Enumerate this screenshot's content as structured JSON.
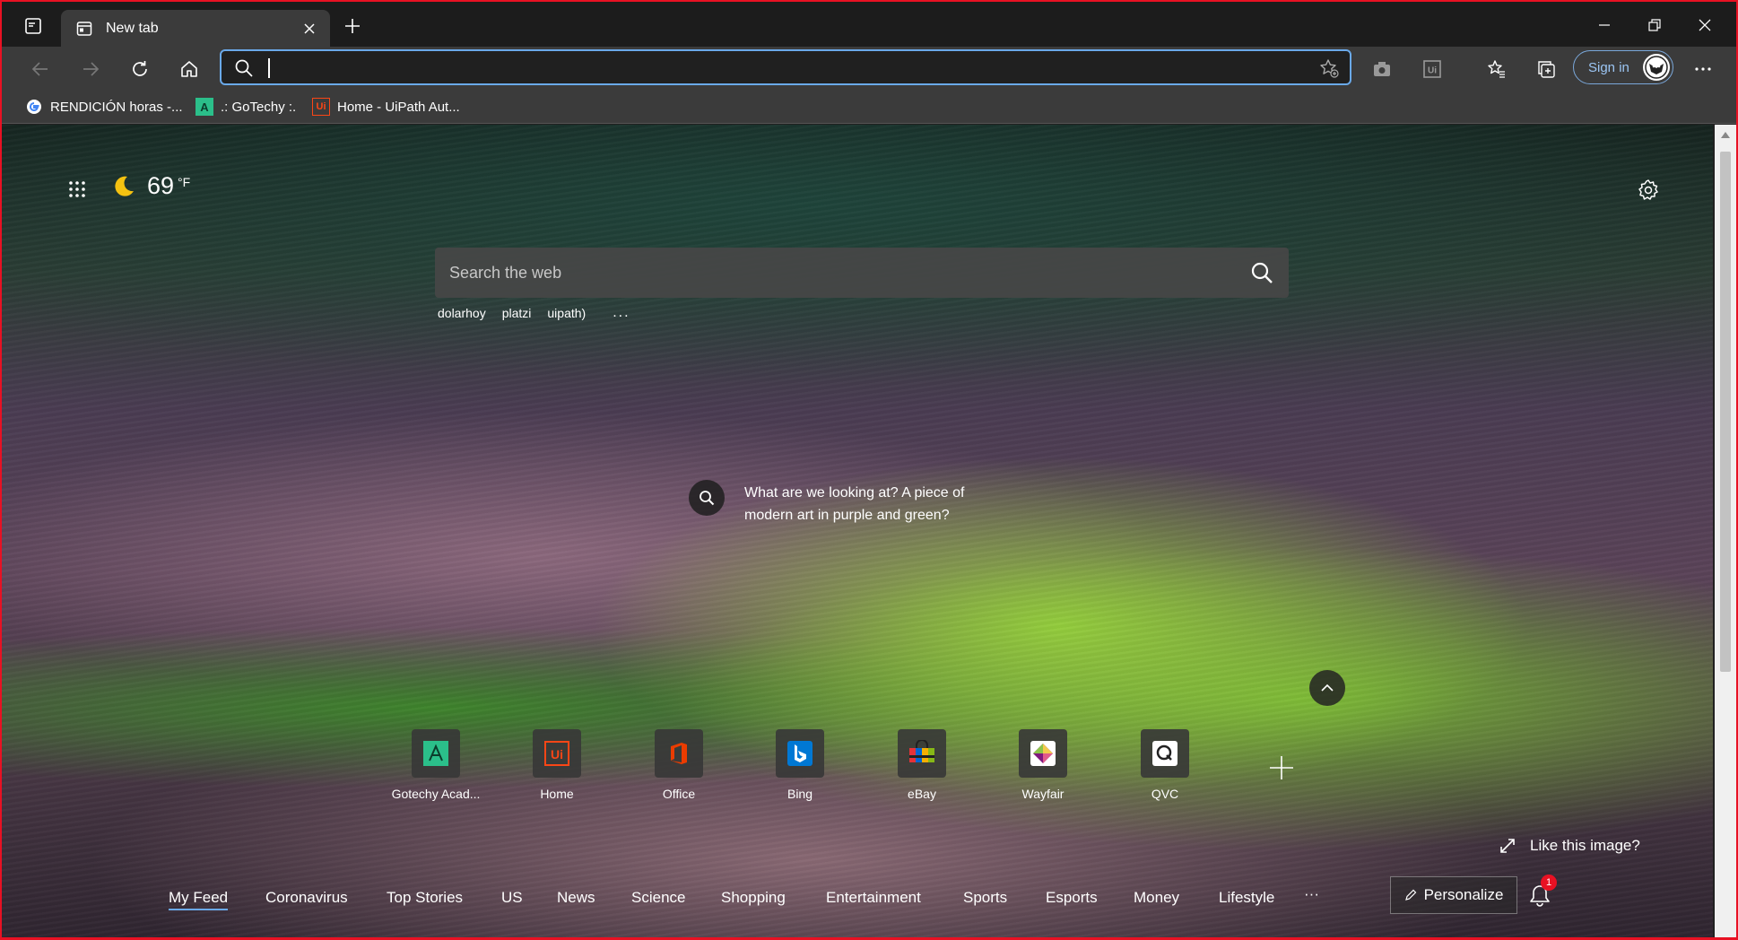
{
  "tabstrip": {
    "tab_title": "New tab",
    "tab_icon": "newtab-page-icon"
  },
  "toolbar": {
    "address_placeholder": "",
    "signin_label": "Sign in"
  },
  "bookmarks": [
    {
      "label": "RENDICIÓN horas -...",
      "icon": "google-icon",
      "color": "#4285f4"
    },
    {
      "label": ".: GoTechy :.",
      "icon": "gotechy-icon",
      "color": "#2bbf8a"
    },
    {
      "label": "Home - UiPath Aut...",
      "icon": "uipath-icon",
      "color": "#fa4616"
    }
  ],
  "weather": {
    "icon": "moon-icon",
    "temperature": "69",
    "unit": "°F"
  },
  "search": {
    "placeholder": "Search the web",
    "suggestions": [
      "dolarhoy",
      "platzi",
      "uipath)"
    ],
    "more": "..."
  },
  "image_info": {
    "question": "What are we looking at? A piece of modern art in purple and green?"
  },
  "quick_links": [
    {
      "label": "Gotechy Acad...",
      "icon": "gotechy-icon",
      "color": "#2bbf8a"
    },
    {
      "label": "Home",
      "icon": "uipath-icon",
      "color": "#fa4616"
    },
    {
      "label": "Office",
      "icon": "office-icon",
      "color": "#eb3c00"
    },
    {
      "label": "Bing",
      "icon": "bing-icon",
      "color": "#0078d4"
    },
    {
      "label": "eBay",
      "icon": "ebay-icon",
      "color": "#e53238"
    },
    {
      "label": "Wayfair",
      "icon": "wayfair-icon",
      "color": "#7f187f"
    },
    {
      "label": "QVC",
      "icon": "qvc-icon",
      "color": "#ffffff"
    }
  ],
  "like_image": "Like this image?",
  "feed": {
    "tabs": [
      "My Feed",
      "Coronavirus",
      "Top Stories",
      "US",
      "News",
      "Science",
      "Shopping",
      "Entertainment",
      "Sports",
      "Esports",
      "Money",
      "Lifestyle"
    ],
    "more": "···",
    "personalize_label": "Personalize",
    "notification_count": "1"
  },
  "colors": {
    "accent": "#6aa9e9",
    "frame_border": "#e81123"
  }
}
